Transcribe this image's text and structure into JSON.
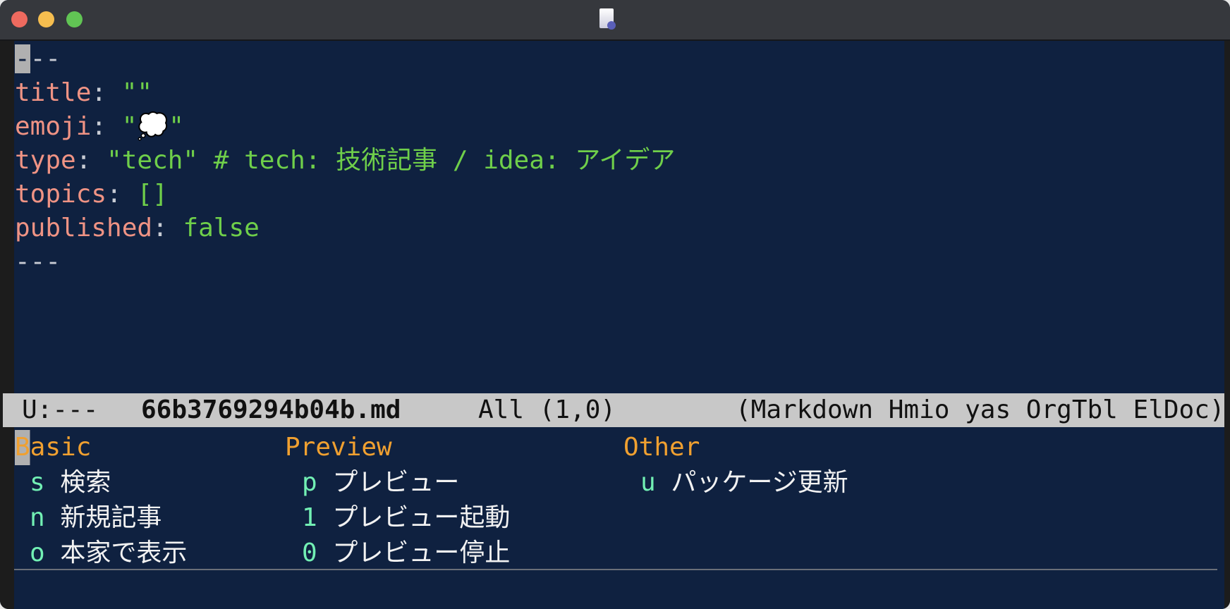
{
  "window": {
    "traffic_lights": [
      "#ee6a5f",
      "#f5bd4f",
      "#61c454"
    ]
  },
  "editor": {
    "lines": [
      {
        "text": "---"
      },
      {
        "key": "title",
        "sep": ": ",
        "value": "\"\""
      },
      {
        "key": "emoji",
        "sep": ": ",
        "value": "\"💭\""
      },
      {
        "key": "type",
        "sep": ": ",
        "value": "\"tech\" # tech: 技術記事 / idea: アイデア"
      },
      {
        "key": "topics",
        "sep": ": ",
        "value": "[]"
      },
      {
        "key": "published",
        "sep": ": ",
        "value": "false"
      },
      {
        "text": "---"
      }
    ]
  },
  "modeline": {
    "status": "U:---",
    "filename": "66b3769294b04b.md",
    "position": "All (1,0)",
    "modes": "(Markdown Hmio yas OrgTbl ElDoc)"
  },
  "menu": {
    "groups": [
      {
        "title": "Basic",
        "items": [
          {
            "key": "s",
            "label": "検索"
          },
          {
            "key": "n",
            "label": "新規記事"
          },
          {
            "key": "o",
            "label": "本家で表示"
          }
        ]
      },
      {
        "title": "Preview",
        "items": [
          {
            "key": "p",
            "label": "プレビュー"
          },
          {
            "key": "1",
            "label": "プレビュー起動"
          },
          {
            "key": "0",
            "label": "プレビュー停止"
          }
        ]
      },
      {
        "title": "Other",
        "items": [
          {
            "key": "u",
            "label": "パッケージ更新"
          }
        ]
      }
    ]
  },
  "colors": {
    "background": "#0f2140",
    "key": "#ef9384",
    "value": "#6fcf4a",
    "heading": "#f0a030",
    "menu_key": "#72f0b4",
    "modeline": "#c8c8c8"
  }
}
